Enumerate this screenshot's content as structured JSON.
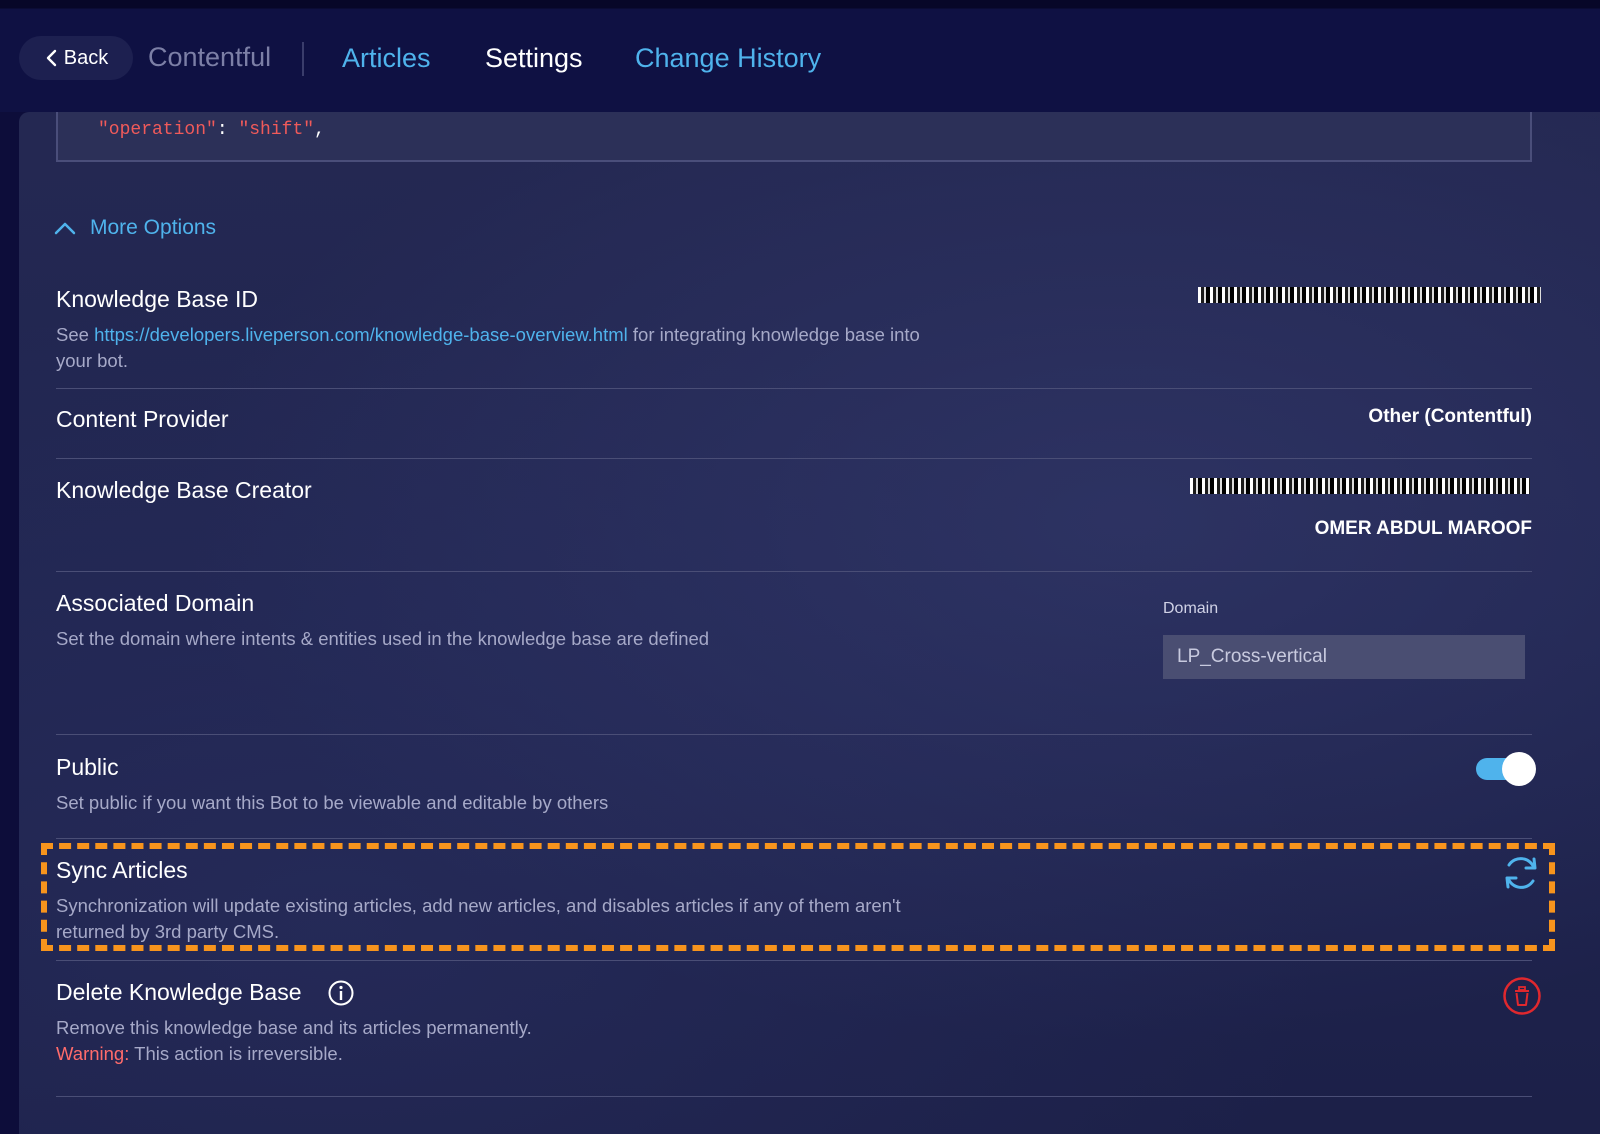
{
  "header": {
    "back_label": "Back",
    "brand": "Contentful",
    "tabs": {
      "articles": "Articles",
      "settings": "Settings",
      "change_history": "Change History"
    }
  },
  "code": {
    "key": "\"operation\"",
    "colon": ": ",
    "value": "\"shift\"",
    "trail": ","
  },
  "more_options": {
    "label": "More Options"
  },
  "kb_id": {
    "title": "Knowledge Base ID",
    "desc_prefix": "See ",
    "link": "https://developers.liveperson.com/knowledge-base-overview.html",
    "desc_suffix": " for integrating knowledge base into your bot."
  },
  "content_provider": {
    "title": "Content Provider",
    "value": "Other (Contentful)"
  },
  "kb_creator": {
    "title": "Knowledge Base Creator",
    "name": "OMER ABDUL MAROOF"
  },
  "associated_domain": {
    "title": "Associated Domain",
    "desc": "Set the domain where intents & entities used in the knowledge base are defined",
    "field_label": "Domain",
    "field_value": "LP_Cross-vertical"
  },
  "public": {
    "title": "Public",
    "desc": "Set public if you want this Bot to be viewable and editable by others",
    "enabled": true
  },
  "sync": {
    "title": "Sync Articles",
    "desc": "Synchronization will update existing articles, add new articles, and disables articles if any of them aren't returned by 3rd party CMS."
  },
  "delete": {
    "title": "Delete Knowledge Base",
    "desc": "Remove this knowledge base and its articles permanently.",
    "warning_label": "Warning:",
    "warning_text": " This action is irreversible."
  },
  "colors": {
    "accent": "#4fb3ec",
    "danger": "#e0282e",
    "highlight": "#f7941d"
  },
  "icons": {
    "back": "chevron-left-icon",
    "more_options": "chevron-up-icon",
    "sync": "sync-icon",
    "info": "info-icon",
    "delete": "trash-icon"
  }
}
